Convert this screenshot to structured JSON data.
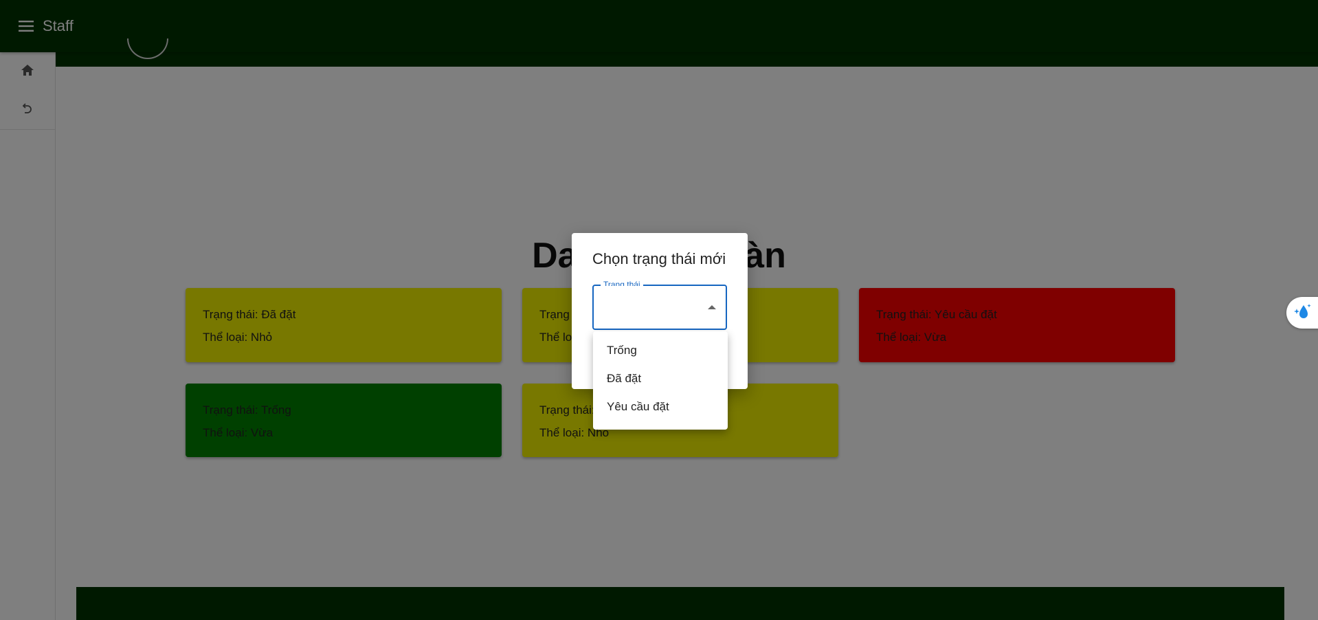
{
  "app": {
    "title": "Staff"
  },
  "sidebar": {
    "items": [
      {
        "icon": "home-icon"
      },
      {
        "icon": "undo-icon"
      }
    ]
  },
  "main": {
    "title": "Danh sách bàn",
    "tables": [
      {
        "status_line": "Trạng thái: Đã đặt",
        "type_line": "Thể loại: Nhỏ",
        "color": "#f0f000"
      },
      {
        "status_line": "Trạng thái: Đã đặt",
        "type_line": "Thể loại: Nhỏ",
        "color": "#f0f000"
      },
      {
        "status_line": "Trạng thái: Yêu cầu đặt",
        "type_line": "Thể loại: Vừa",
        "color": "#ff0000"
      },
      {
        "status_line": "Trạng thái: Trống",
        "type_line": "Thể loại: Vừa",
        "color": "#008000"
      },
      {
        "status_line": "Trạng thái: Đã đặt",
        "type_line": "Thể loại: Nhỏ",
        "color": "#f0f000"
      }
    ]
  },
  "dialog": {
    "title": "Chọn trạng thái mới",
    "select": {
      "label": "Trạng thái",
      "value": ""
    },
    "options": [
      "Trống",
      "Đã đặt",
      "Yêu cầu đặt"
    ]
  },
  "colors": {
    "header_green": "#003300",
    "accent_blue": "#1565c0"
  }
}
